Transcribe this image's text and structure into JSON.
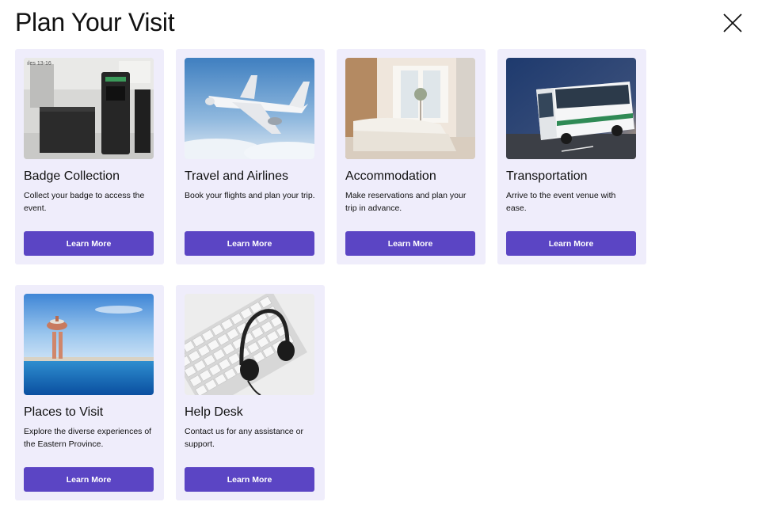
{
  "header": {
    "title": "Plan Your Visit",
    "close_icon": "close-icon"
  },
  "colors": {
    "card_bg": "#efedfb",
    "button_bg": "#5b45c4",
    "button_text": "#ffffff"
  },
  "cards": [
    {
      "title": "Badge Collection",
      "description": "Collect your badge to access the event.",
      "button": "Learn More",
      "image": "badge-kiosk-image"
    },
    {
      "title": "Travel and Airlines",
      "description": "Book your flights and plan your trip.",
      "button": "Learn More",
      "image": "airplane-image"
    },
    {
      "title": "Accommodation",
      "description": "Make reservations and plan your trip in advance.",
      "button": "Learn More",
      "image": "hotel-room-image"
    },
    {
      "title": "Transportation",
      "description": "Arrive to the event venue with ease.",
      "button": "Learn More",
      "image": "bus-image"
    },
    {
      "title": "Places to Visit",
      "description": "Explore the diverse experiences of the Eastern Province.",
      "button": "Learn More",
      "image": "water-tower-image"
    },
    {
      "title": "Help Desk",
      "description": "Contact us for any assistance or support.",
      "button": "Learn More",
      "image": "headset-keyboard-image"
    }
  ]
}
